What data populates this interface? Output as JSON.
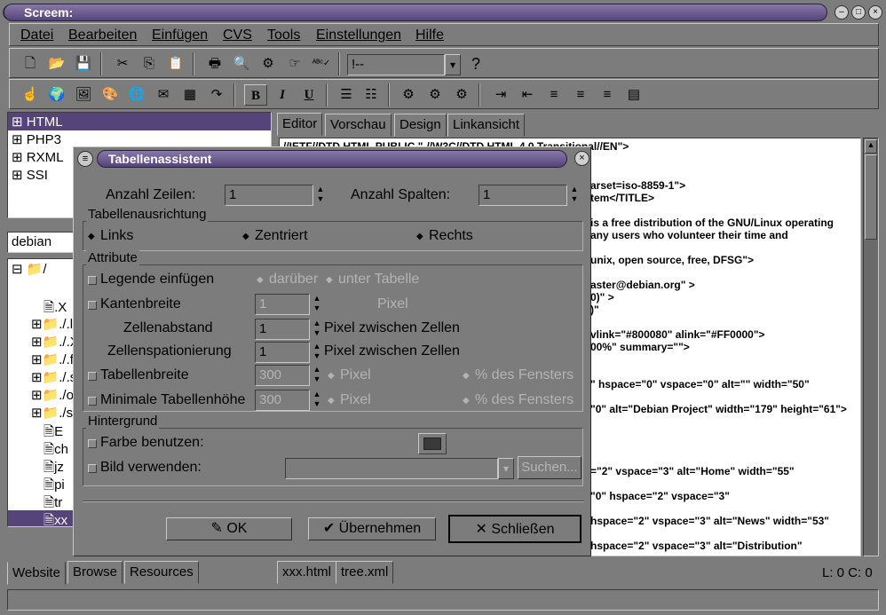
{
  "window": {
    "title": "Screem:"
  },
  "menu": [
    "Datei",
    "Bearbeiten",
    "Einfügen",
    "CVS",
    "Tools",
    "Einstellungen",
    "Hilfe"
  ],
  "toolbar": {
    "combo_value": "!--",
    "help_icon": "?",
    "bold": "B",
    "italic": "I",
    "underline": "U"
  },
  "left_tree": {
    "items": [
      "HTML",
      "PHP3",
      "RXML",
      "SSI"
    ]
  },
  "dir_combo": {
    "value": "debian"
  },
  "file_tree": {
    "root": "/",
    "items": [
      ".X",
      "./.l",
      "./.X",
      "./.f",
      "./.s",
      "./o",
      "./s",
      "E",
      "ch",
      "jz",
      "pi",
      "tr",
      "xx"
    ]
  },
  "editor_tabs": [
    "Editor",
    "Vorschau",
    "Design",
    "Linkansicht"
  ],
  "code_lines": [
    "//IETF//DTD HTML PUBLIC \"-//W3C//DTD HTML 4.0 Transitional//EN\">",
    "arset=iso-8859-1\">",
    "tem</TITLE>",
    "is a free distribution of the GNU/Linux operating",
    "any users who volunteer their time and",
    "unix, open source, free, DFSG\">",
    "aster@debian.org\"   >",
    "0)\"   >",
    ")\"",
    "vlink=\"#800080\" alink=\"#FF0000\">",
    "00%\" summary=\"\">",
    "\" hspace=\"0\" vspace=\"0\" alt=\"\" width=\"50\"",
    "\"0\" alt=\"Debian Project\" width=\"179\" height=\"61\">",
    "=\"2\" vspace=\"3\" alt=\"Home\" width=\"55\"",
    "\"0\" hspace=\"2\" vspace=\"3\"",
    "hspace=\"2\" vspace=\"3\" alt=\"News\" width=\"53\"",
    "hspace=\"2\" vspace=\"3\" alt=\"Distribution\""
  ],
  "bottom_tabs": [
    "Website",
    "Browse",
    "Resources"
  ],
  "doc_tabs": [
    "xxx.html",
    "tree.xml"
  ],
  "status": {
    "position": "L: 0 C: 0"
  },
  "dialog": {
    "title": "Tabellenassistent",
    "rows_label": "Anzahl Zeilen:",
    "rows_value": "1",
    "cols_label": "Anzahl Spalten:",
    "cols_value": "1",
    "align_group": "Tabellenausrichtung",
    "align_left": "Links",
    "align_center": "Zentriert",
    "align_right": "Rechts",
    "attr_group": "Attribute",
    "caption_label": "Legende einfügen",
    "caption_above": "darüber",
    "caption_below": "unter Tabelle",
    "border_label": "Kantenbreite",
    "border_value": "1",
    "border_unit": "Pixel",
    "spacing_label": "Zellenabstand",
    "spacing_value": "1",
    "spacing_unit": "Pixel zwischen Zellen",
    "padding_label": "Zellenspationierung",
    "padding_value": "1",
    "padding_unit": "Pixel zwischen Zellen",
    "width_label": "Tabellenbreite",
    "width_value": "300",
    "width_pixel": "Pixel",
    "width_percent": "% des Fensters",
    "minheight_label": "Minimale Tabellenhöhe",
    "minheight_value": "300",
    "minheight_pixel": "Pixel",
    "minheight_percent": "% des Fensters",
    "bg_group": "Hintergrund",
    "color_label": "Farbe benutzen:",
    "image_label": "Bild verwenden:",
    "search_button": "Suchen...",
    "ok": "OK",
    "apply": "Übernehmen",
    "close": "Schließen"
  }
}
